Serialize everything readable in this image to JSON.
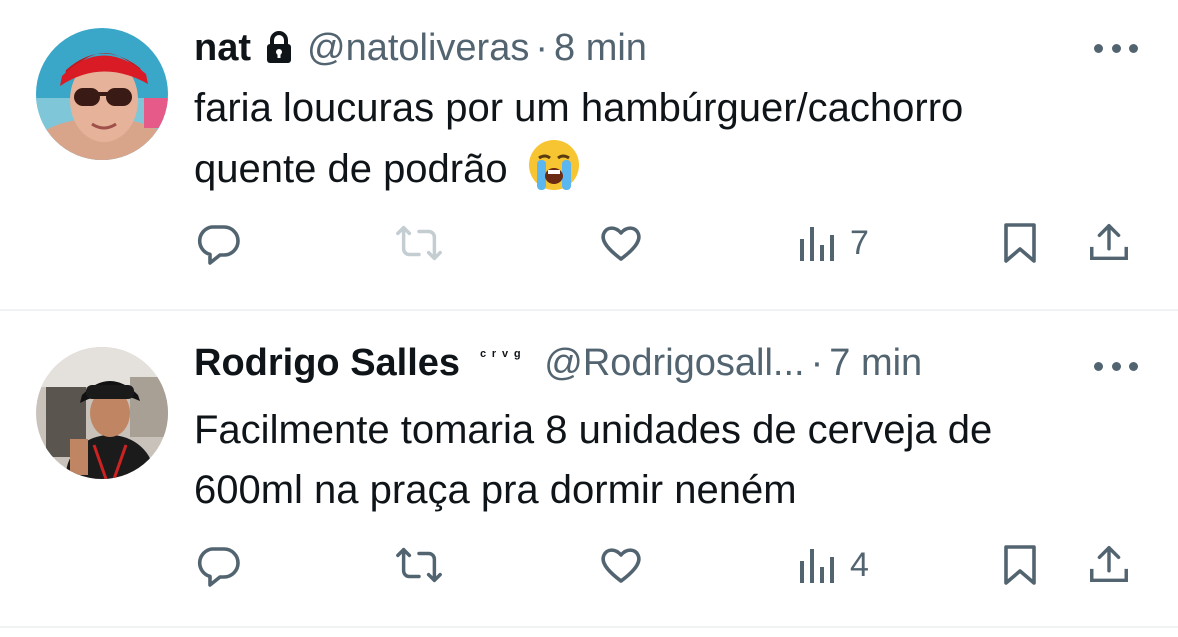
{
  "tweets": [
    {
      "author": {
        "name": "nat",
        "handle": "@natoliveras",
        "protected": true,
        "badge": ""
      },
      "time": "8 min",
      "text_line1": "faria loucuras por um hambúrguer/cachorro",
      "text_line2": "quente de podrão",
      "emoji": "loudly-crying-face",
      "views": "7"
    },
    {
      "author": {
        "name": "Rodrigo Salles",
        "handle": "@Rodrigosall...",
        "protected": false,
        "badge": "ᶜʳᵛᵍ"
      },
      "time": "7 min",
      "text_line1": "Facilmente tomaria 8 unidades de cerveja de",
      "text_line2": "600ml na praça pra dormir neném",
      "views": "4"
    }
  ],
  "separator": "·",
  "colors": {
    "text": "#0f1419",
    "secondary": "#536471",
    "divider": "#eff3f4"
  }
}
